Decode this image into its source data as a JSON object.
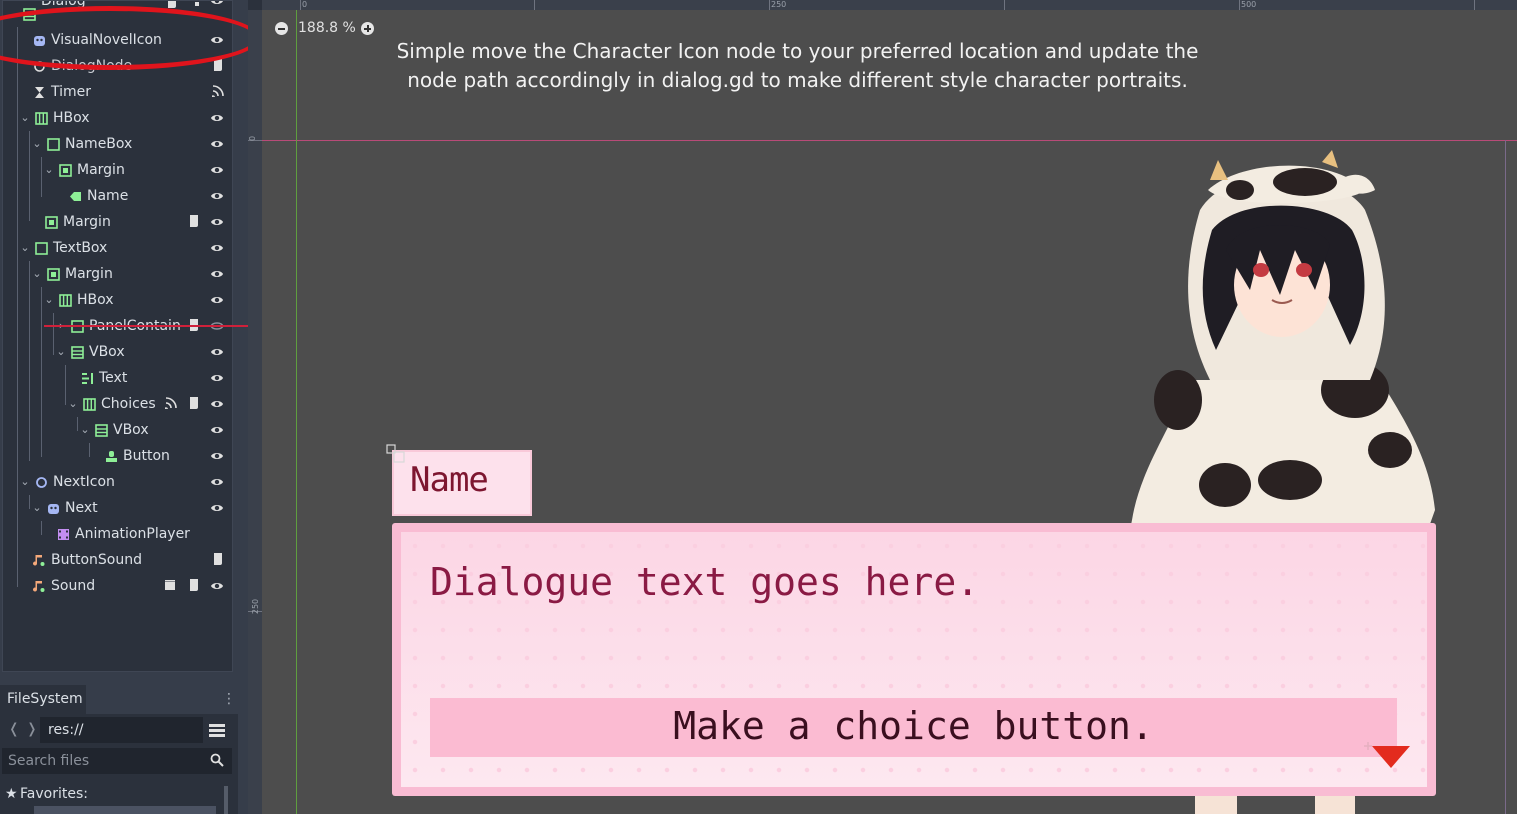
{
  "scene_tree": {
    "items": [
      {
        "label": "Dialog",
        "icon": "vbox-icon"
      },
      {
        "label": "VisualNovelIcon",
        "icon": "sprite-icon"
      },
      {
        "label": "DialogNode",
        "icon": "node-icon"
      },
      {
        "label": "Timer",
        "icon": "timer-icon"
      },
      {
        "label": "HBox",
        "icon": "hbox-icon"
      },
      {
        "label": "NameBox",
        "icon": "panel-icon"
      },
      {
        "label": "Margin",
        "icon": "margin-icon"
      },
      {
        "label": "Name",
        "icon": "label-icon"
      },
      {
        "label": "Margin",
        "icon": "margin-icon"
      },
      {
        "label": "TextBox",
        "icon": "panel-icon"
      },
      {
        "label": "Margin",
        "icon": "margin-icon"
      },
      {
        "label": "HBox",
        "icon": "hbox-icon"
      },
      {
        "label": "PanelContain",
        "icon": "panel-icon"
      },
      {
        "label": "VBox",
        "icon": "vbox-icon"
      },
      {
        "label": "Text",
        "icon": "richtext-icon"
      },
      {
        "label": "Choices",
        "icon": "hbox-icon"
      },
      {
        "label": "VBox",
        "icon": "vbox-icon"
      },
      {
        "label": "Button",
        "icon": "button-icon"
      },
      {
        "label": "NextIcon",
        "icon": "node2d-icon"
      },
      {
        "label": "Next",
        "icon": "sprite-icon"
      },
      {
        "label": "AnimationPlayer",
        "icon": "animation-icon"
      },
      {
        "label": "ButtonSound",
        "icon": "audio-icon"
      },
      {
        "label": "Sound",
        "icon": "audio-icon"
      }
    ]
  },
  "filesystem": {
    "tab_label": "FileSystem",
    "path": "res://",
    "search_placeholder": "Search files",
    "favorites_label": "Favorites:"
  },
  "viewport": {
    "zoom": "188.8 %",
    "ruler_top": [
      "0",
      "250",
      "500"
    ],
    "ruler_left": [
      "0",
      "250"
    ],
    "note": "Simple move the Character Icon node to your preferred location and update the node path accordingly in dialog.gd to make different style character portraits."
  },
  "scene": {
    "name_text": "Name",
    "dialog_text": "Dialogue text goes here.",
    "choice_text": "Make a choice button."
  },
  "colors": {
    "accent_red": "#e0141c",
    "textbox_pink": "#f9bcd3",
    "dialog_text": "#8a1a44"
  }
}
